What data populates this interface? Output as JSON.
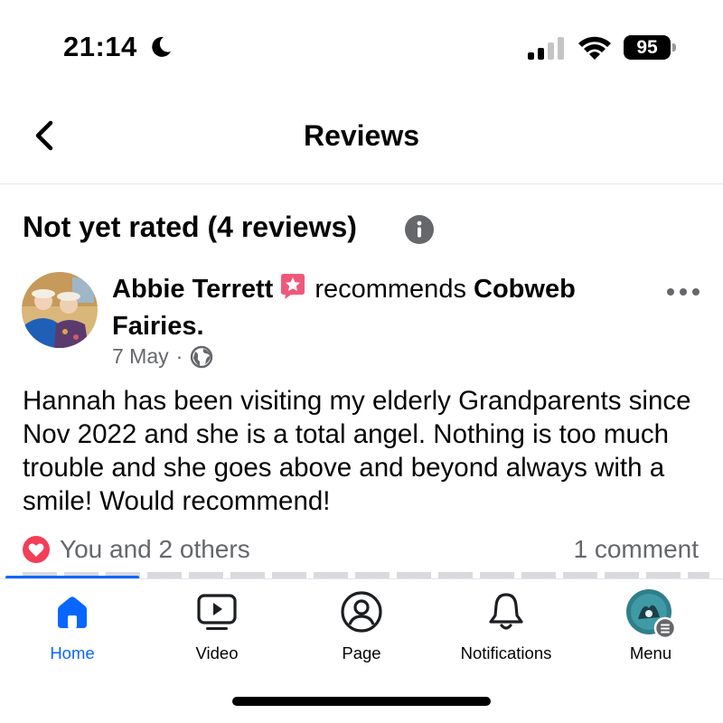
{
  "status_bar": {
    "time": "21:14",
    "battery": "95"
  },
  "header": {
    "title": "Reviews"
  },
  "section": {
    "title": "Not yet rated (4 reviews)"
  },
  "review": {
    "author": "Abbie Terrett",
    "action": "recommends",
    "page_name": "Cobweb Fairies.",
    "date": "7 May",
    "separator": "·",
    "text": "Hannah has been visiting my elderly Grandparents since Nov 2022 and she is a total angel. Nothing is too much trouble and she goes above and beyond always with a smile! Would recommend!",
    "reactions": "You and 2 others",
    "comments": "1 comment"
  },
  "tabs": [
    {
      "label": "Home",
      "icon": "home-icon",
      "active": true
    },
    {
      "label": "Video",
      "icon": "video-icon"
    },
    {
      "label": "Page",
      "icon": "profile-icon"
    },
    {
      "label": "Notifications",
      "icon": "bell-icon"
    },
    {
      "label": "Menu",
      "icon": "menu-avatar"
    }
  ],
  "colors": {
    "accent": "#0866ff",
    "secondary_text": "#65676b",
    "heart": "#f33e58",
    "badge": "#f0587a"
  }
}
